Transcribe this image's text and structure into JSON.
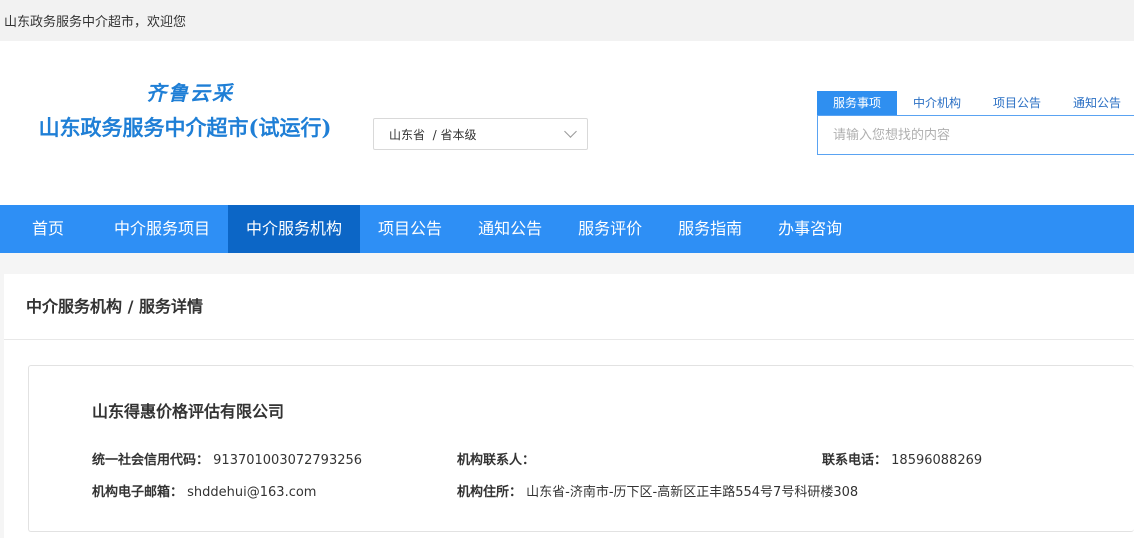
{
  "topbar": {
    "welcome": "山东政务服务中介超市，欢迎您"
  },
  "header": {
    "logo_sub": "齐鲁云采",
    "logo_main": "山东政务服务中介超市(试运行)",
    "region_value": "山东省  / 省本级",
    "search_tabs": [
      "服务事项",
      "中介机构",
      "项目公告",
      "通知公告"
    ],
    "search_placeholder": "请输入您想找的内容"
  },
  "nav": {
    "items": [
      "首页",
      "中介服务项目",
      "中介服务机构",
      "项目公告",
      "通知公告",
      "服务评价",
      "服务指南",
      "办事咨询"
    ]
  },
  "breadcrumb": "中介服务机构 / 服务详情",
  "detail": {
    "company": "山东得惠价格评估有限公司",
    "credit_label": "统一社会信用代码：",
    "credit_value": "913701003072793256",
    "contact_label": "机构联系人：",
    "contact_value": "",
    "phone_label": "联系电话：",
    "phone_value": "18596088269",
    "email_label": "机构电子邮箱：",
    "email_value": "shddehui@163.com",
    "address_label": "机构住所：",
    "address_value": "山东省-济南市-历下区-高新区正丰路554号7号科研楼308"
  },
  "colors": {
    "brand": "#1f7fd6",
    "nav": "#2e8ff5",
    "nav_active": "#0c66c6"
  }
}
